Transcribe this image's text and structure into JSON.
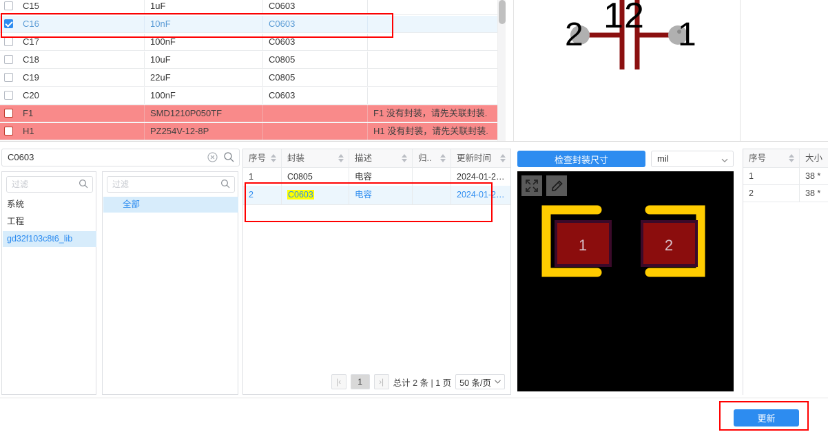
{
  "bom_table": {
    "columns": [
      "checkbox",
      "designator",
      "value",
      "footprint",
      "message"
    ],
    "rows": [
      {
        "checked": false,
        "designator": "C15",
        "value": "1uF",
        "footprint": "C0603",
        "message": "",
        "state": "normal"
      },
      {
        "checked": true,
        "designator": "C16",
        "value": "10nF",
        "footprint": "C0603",
        "message": "",
        "state": "selected"
      },
      {
        "checked": false,
        "designator": "C17",
        "value": "100nF",
        "footprint": "C0603",
        "message": "",
        "state": "normal"
      },
      {
        "checked": false,
        "designator": "C18",
        "value": "10uF",
        "footprint": "C0805",
        "message": "",
        "state": "normal"
      },
      {
        "checked": false,
        "designator": "C19",
        "value": "22uF",
        "footprint": "C0805",
        "message": "",
        "state": "normal"
      },
      {
        "checked": false,
        "designator": "C20",
        "value": "100nF",
        "footprint": "C0603",
        "message": "",
        "state": "normal"
      },
      {
        "checked": false,
        "designator": "F1",
        "value": "SMD1210P050TF",
        "footprint": "",
        "message": "F1 没有封装，请先关联封装.",
        "state": "error"
      },
      {
        "checked": false,
        "designator": "H1",
        "value": "PZ254V-12-8P",
        "footprint": "",
        "message": "H1 没有封装，请先关联封装.",
        "state": "error"
      }
    ]
  },
  "schematic_preview": {
    "pin_left_label": "2",
    "pin_right_label": "1",
    "top_label_left": "1",
    "top_label_right": "2",
    "symbol_color": "#8b1010",
    "pin_dot_color": "#b0b0b0"
  },
  "library_search": {
    "value": "C0603",
    "clear_icon": "circle-x-icon",
    "search_icon": "search-icon"
  },
  "library_category": {
    "filter_placeholder": "过滤",
    "items": [
      {
        "label": "系统",
        "active": false
      },
      {
        "label": "工程",
        "active": false
      },
      {
        "label": "gd32f103c8t6_lib",
        "active": true
      }
    ]
  },
  "library_subcategory": {
    "filter_placeholder": "过滤",
    "items": [
      {
        "label": "全部",
        "active": true
      }
    ]
  },
  "footprint_table": {
    "headers": [
      "序号",
      "封装",
      "描述",
      "归..",
      "更新时间"
    ],
    "rows": [
      {
        "index": "1",
        "footprint": "C0805",
        "description": "电容",
        "owner": "",
        "updated": "2024-01-2…",
        "selected": false,
        "highlight": false
      },
      {
        "index": "2",
        "footprint": "C0603",
        "description": "电容",
        "owner": "",
        "updated": "2024-01-2…",
        "selected": true,
        "highlight": true
      }
    ],
    "pagination": {
      "first_label": "|‹",
      "last_label": "›|",
      "current_page": "1",
      "total_text": "总计 2 条 | 1 页",
      "page_size": "50 条/页"
    }
  },
  "pcb_preview": {
    "check_size_label": "检查封装尺寸",
    "unit_value": "mil",
    "tools": [
      {
        "name": "fit-screen-icon"
      },
      {
        "name": "edit-pencil-icon"
      }
    ],
    "pads": [
      {
        "label": "1"
      },
      {
        "label": "2"
      }
    ],
    "pad_color": "#8b0d0d",
    "pad_border_color": "#3b0a2a",
    "outline_color": "#ffcc00",
    "canvas_color": "#000000"
  },
  "size_table": {
    "headers": [
      "序号",
      "大小"
    ],
    "rows": [
      {
        "index": "1",
        "size": "38 *"
      },
      {
        "index": "2",
        "size": "38 *"
      }
    ]
  },
  "footer": {
    "update_label": "更新"
  },
  "theme": {
    "primary": "#2d8cf0",
    "selected_row": "#ecf6fd",
    "error_row": "#f98a8a",
    "annotation": "#ff0000",
    "highlight": "#ffff00"
  }
}
